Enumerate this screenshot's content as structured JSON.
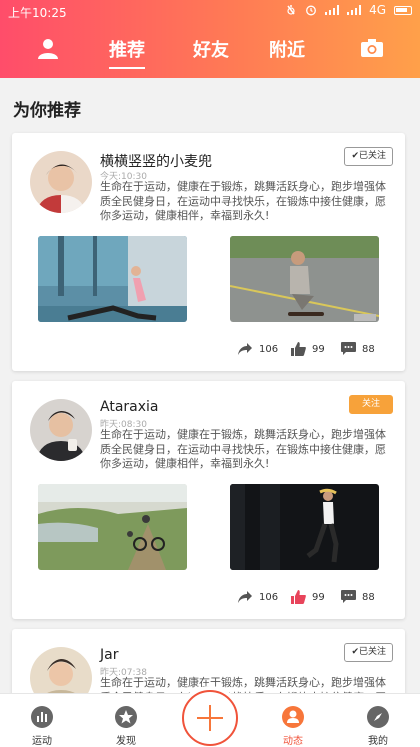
{
  "status": {
    "time": "上午10:25",
    "network": "4G"
  },
  "nav": {
    "tabs": [
      {
        "label": "推荐"
      },
      {
        "label": "好友"
      },
      {
        "label": "附近"
      }
    ]
  },
  "section_title": "为你推荐",
  "posts": [
    {
      "name": "横横竖竖的小麦兜",
      "time": "今天:10:30",
      "text": "生命在于运动，健康在于锻炼，跳舞活跃身心，跑步增强体质全民健身日，在运动中寻找快乐，在锻炼中接住健康，愿你多运动，健康相伴，幸福到永久!",
      "follow": "已关注",
      "shares": "106",
      "likes": "99",
      "comments": "88"
    },
    {
      "name": "Ataraxia",
      "time": "昨天:08:30",
      "text": "生命在于运动，健康在于锻炼，跳舞活跃身心，跑步增强体质全民健身日，在运动中寻找快乐，在锻炼中接住健康，愿你多运动，健康相伴，幸福到永久!",
      "follow": "关注",
      "shares": "106",
      "likes": "99",
      "comments": "88"
    },
    {
      "name": "Jar",
      "time": "昨天:07:38",
      "text": "生命在于运动，健康在于锻炼，跳舞活跃身心，跑步增强体质全民健身日，在运动中寻找快乐，在锻炼中接住健康，愿你多运动，健康相伴，幸福到永久!",
      "follow": "已关注"
    }
  ],
  "bottom": [
    {
      "label": "运动"
    },
    {
      "label": "发现"
    },
    {
      "label": "动态"
    },
    {
      "label": "我的"
    }
  ],
  "colors": {
    "accent": "#f0533a",
    "follow": "#f7a23a",
    "like_active": "#e8445b"
  }
}
